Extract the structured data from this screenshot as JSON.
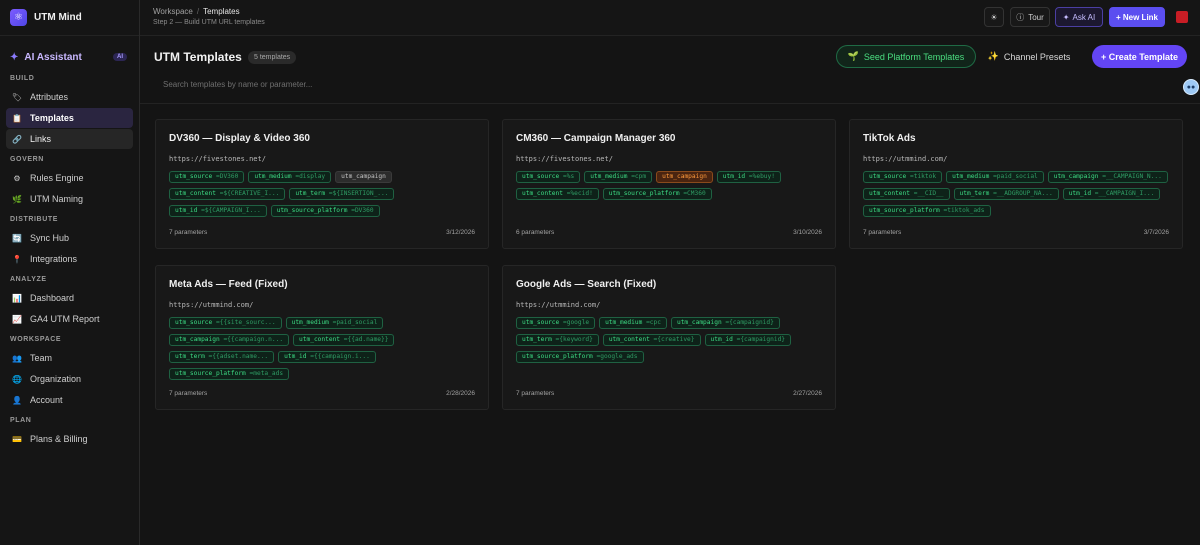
{
  "app": {
    "name": "UTM Mind"
  },
  "sidebar": {
    "ai": {
      "label": "AI Assistant",
      "badge": "AI"
    },
    "sections": [
      {
        "title": "BUILD",
        "items": [
          {
            "label": "Attributes",
            "icon": "tag-icon",
            "state": ""
          },
          {
            "label": "Templates",
            "icon": "clipboard-icon",
            "state": "active"
          },
          {
            "label": "Links",
            "icon": "link-icon",
            "state": "hover"
          }
        ]
      },
      {
        "title": "GOVERN",
        "items": [
          {
            "label": "Rules Engine",
            "icon": "gear-icon",
            "state": ""
          },
          {
            "label": "UTM Naming",
            "icon": "leaf-icon",
            "state": ""
          }
        ]
      },
      {
        "title": "DISTRIBUTE",
        "items": [
          {
            "label": "Sync Hub",
            "icon": "sync-icon",
            "state": ""
          },
          {
            "label": "Integrations",
            "icon": "plug-icon",
            "state": ""
          }
        ]
      },
      {
        "title": "ANALYZE",
        "items": [
          {
            "label": "Dashboard",
            "icon": "bar-chart-icon",
            "state": ""
          },
          {
            "label": "GA4 UTM Report",
            "icon": "line-chart-icon",
            "state": ""
          }
        ]
      },
      {
        "title": "WORKSPACE",
        "items": [
          {
            "label": "Team",
            "icon": "team-icon",
            "state": ""
          },
          {
            "label": "Organization",
            "icon": "globe-icon",
            "state": ""
          },
          {
            "label": "Account",
            "icon": "user-icon",
            "state": ""
          }
        ]
      },
      {
        "title": "PLAN",
        "items": [
          {
            "label": "Plans & Billing",
            "icon": "card-icon",
            "state": ""
          }
        ]
      }
    ]
  },
  "topbar": {
    "breadcrumb": {
      "root": "Workspace",
      "separator": "/",
      "current": "Templates"
    },
    "step": "Step 2 — Build UTM URL templates",
    "tour": "Tour",
    "ask_ai": "Ask AI",
    "new_link": "+ New Link"
  },
  "main": {
    "title": "UTM Templates",
    "count": "5 templates",
    "seed_button": "Seed Platform Templates",
    "presets_button": "Channel Presets",
    "create_button": "+ Create Template",
    "search_placeholder": "Search templates by name or parameter..."
  },
  "cards": [
    {
      "name": "DV360 — Display & Video 360",
      "url": "https://fivestones.net/",
      "params": [
        {
          "k": "utm_source",
          "v": "=DV360",
          "style": "green"
        },
        {
          "k": "utm_medium",
          "v": "=display",
          "style": "green"
        },
        {
          "k": "utm_campaign",
          "v": "",
          "style": "gray"
        },
        {
          "k": "utm_content",
          "v": "=${CREATIVE_I...",
          "style": "green"
        },
        {
          "k": "utm_term",
          "v": "=${INSERTION_...",
          "style": "green"
        },
        {
          "k": "utm_id",
          "v": "=${CAMPAIGN_I...",
          "style": "green"
        },
        {
          "k": "utm_source_platform",
          "v": "=DV360",
          "style": "green"
        }
      ],
      "param_count": "7 parameters",
      "date": "3/12/2026"
    },
    {
      "name": "CM360 — Campaign Manager 360",
      "url": "https://fivestones.net/",
      "params": [
        {
          "k": "utm_source",
          "v": "=%s",
          "style": "green"
        },
        {
          "k": "utm_medium",
          "v": "=cpm",
          "style": "green"
        },
        {
          "k": "utm_campaign",
          "v": "",
          "style": "orange"
        },
        {
          "k": "utm_id",
          "v": "=%ebuy!",
          "style": "green"
        },
        {
          "k": "utm_content",
          "v": "=%ecid!",
          "style": "green"
        },
        {
          "k": "utm_source_platform",
          "v": "=CM360",
          "style": "green"
        }
      ],
      "param_count": "6 parameters",
      "date": "3/10/2026"
    },
    {
      "name": "TikTok Ads",
      "url": "https://utmmind.com/",
      "params": [
        {
          "k": "utm_source",
          "v": "=tiktok",
          "style": "green"
        },
        {
          "k": "utm_medium",
          "v": "=paid_social",
          "style": "green"
        },
        {
          "k": "utm_campaign",
          "v": "=__CAMPAIGN_N...",
          "style": "green"
        },
        {
          "k": "utm_content",
          "v": "=__CID__",
          "style": "green"
        },
        {
          "k": "utm_term",
          "v": "=__ADGROUP_NA...",
          "style": "green"
        },
        {
          "k": "utm_id",
          "v": "=__CAMPAIGN_I...",
          "style": "green"
        },
        {
          "k": "utm_source_platform",
          "v": "=tiktok_ads",
          "style": "green"
        }
      ],
      "param_count": "7 parameters",
      "date": "3/7/2026"
    },
    {
      "name": "Meta Ads — Feed (Fixed)",
      "url": "https://utmmind.com/",
      "params": [
        {
          "k": "utm_source",
          "v": "={{site_sourc...",
          "style": "green"
        },
        {
          "k": "utm_medium",
          "v": "=paid_social",
          "style": "green"
        },
        {
          "k": "utm_campaign",
          "v": "={{campaign.n...",
          "style": "green"
        },
        {
          "k": "utm_content",
          "v": "={{ad.name}}",
          "style": "green"
        },
        {
          "k": "utm_term",
          "v": "={{adset.name...",
          "style": "green"
        },
        {
          "k": "utm_id",
          "v": "={{campaign.i...",
          "style": "green"
        },
        {
          "k": "utm_source_platform",
          "v": "=meta_ads",
          "style": "green"
        }
      ],
      "param_count": "7 parameters",
      "date": "2/28/2026"
    },
    {
      "name": "Google Ads — Search (Fixed)",
      "url": "https://utmmind.com/",
      "params": [
        {
          "k": "utm_source",
          "v": "=google",
          "style": "green"
        },
        {
          "k": "utm_medium",
          "v": "=cpc",
          "style": "green"
        },
        {
          "k": "utm_campaign",
          "v": "={campaignid}",
          "style": "green"
        },
        {
          "k": "utm_term",
          "v": "={keyword}",
          "style": "green"
        },
        {
          "k": "utm_content",
          "v": "={creative}",
          "style": "green"
        },
        {
          "k": "utm_id",
          "v": "={campaignid}",
          "style": "green"
        },
        {
          "k": "utm_source_platform",
          "v": "=google_ads",
          "style": "green"
        }
      ],
      "param_count": "7 parameters",
      "date": "2/27/2026"
    }
  ]
}
